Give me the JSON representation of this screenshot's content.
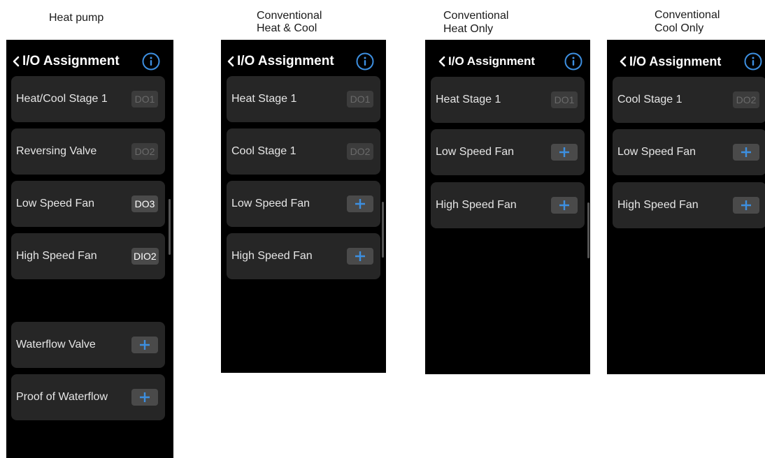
{
  "captions": {
    "heat_pump": "Heat pump",
    "conv_heat_cool_1": "Conventional",
    "conv_heat_cool_2": "Heat & Cool",
    "conv_heat_only_1": "Conventional",
    "conv_heat_only_2": "Heat Only",
    "conv_cool_only_1": "Conventional",
    "conv_cool_only_2": "Cool Only"
  },
  "header": {
    "title": "I/O Assignment"
  },
  "colors": {
    "accent": "#3d8fe0",
    "card": "#262626",
    "screen": "#000000"
  },
  "screens": {
    "heat_pump": {
      "items": [
        {
          "label": "Heat/Cool Stage 1",
          "badge": "DO1"
        },
        {
          "label": "Reversing Valve",
          "badge": "DO2"
        },
        {
          "label": "Low Speed Fan",
          "badge": "DO3"
        },
        {
          "label": "High Speed Fan",
          "badge": "DIO2"
        },
        {
          "label": "Waterflow Valve"
        },
        {
          "label": "Proof of Waterflow"
        }
      ]
    },
    "heat_cool": {
      "items": [
        {
          "label": "Heat Stage 1",
          "badge": "DO1"
        },
        {
          "label": "Cool Stage 1",
          "badge": "DO2"
        },
        {
          "label": "Low Speed Fan"
        },
        {
          "label": "High Speed Fan"
        }
      ]
    },
    "heat_only": {
      "items": [
        {
          "label": "Heat Stage 1",
          "badge": "DO1"
        },
        {
          "label": "Low Speed Fan"
        },
        {
          "label": "High Speed Fan"
        }
      ]
    },
    "cool_only": {
      "items": [
        {
          "label": "Cool Stage 1",
          "badge": "DO2"
        },
        {
          "label": "Low Speed Fan"
        },
        {
          "label": "High Speed Fan"
        }
      ]
    }
  }
}
